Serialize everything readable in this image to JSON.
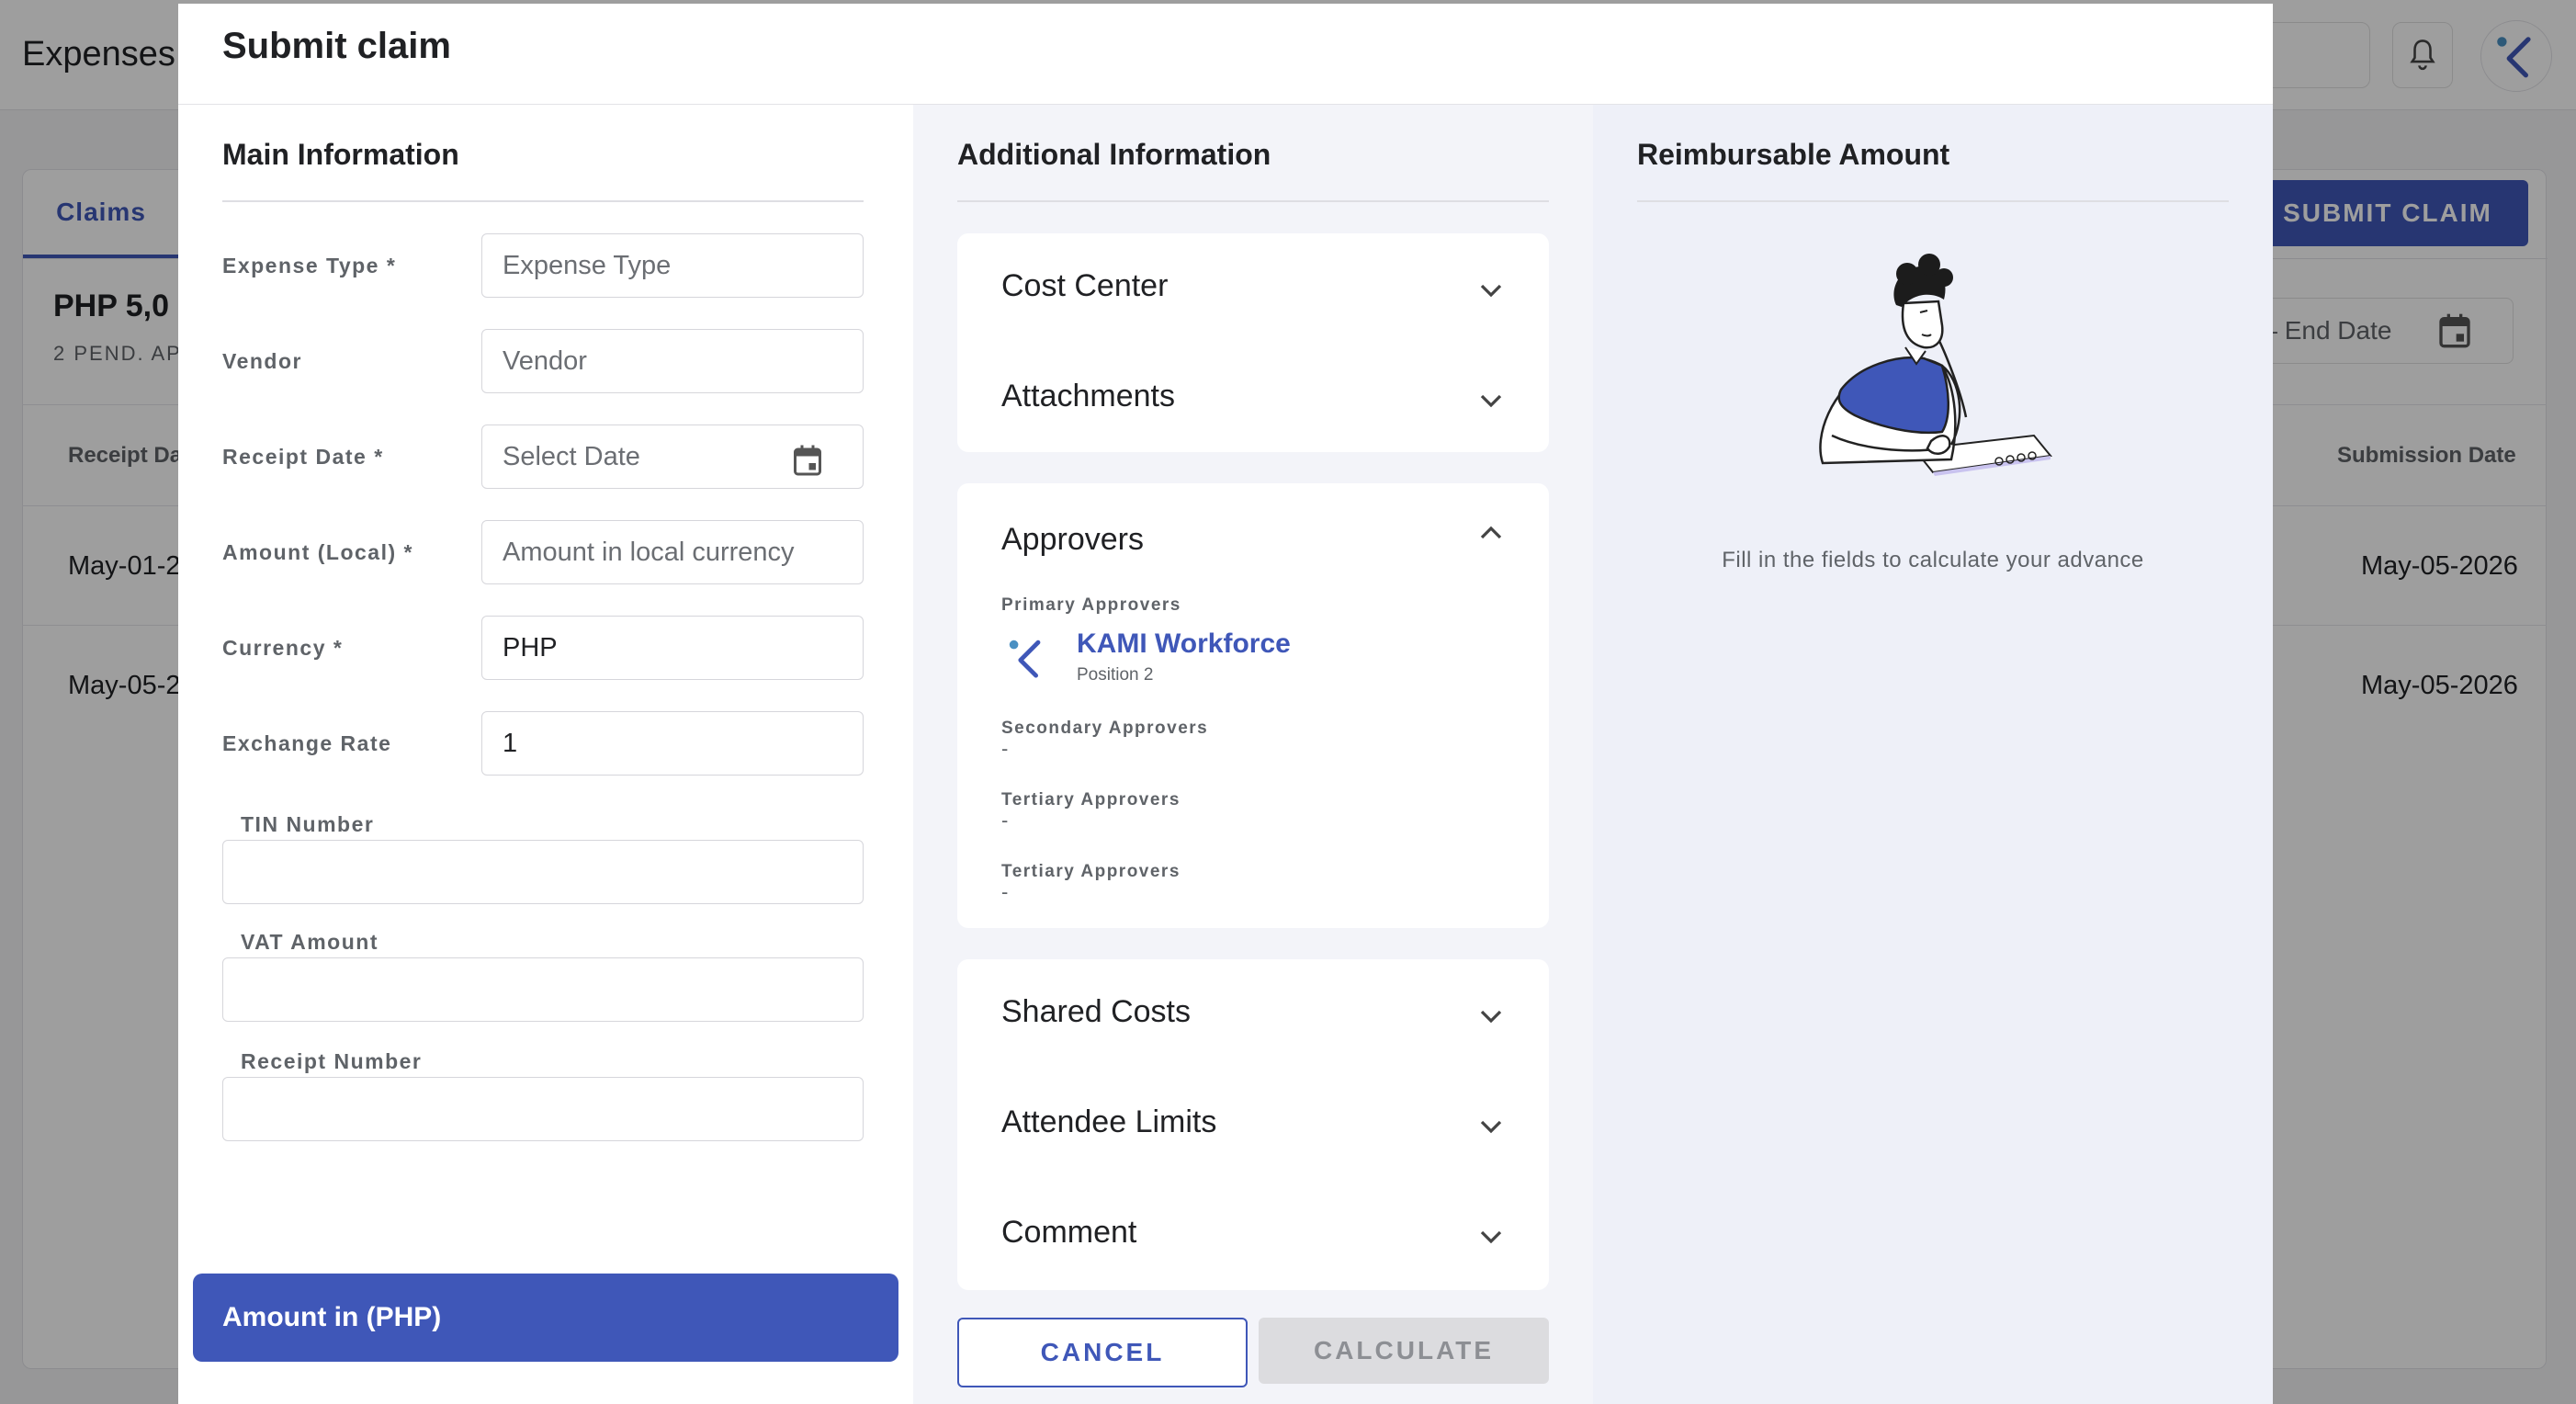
{
  "background": {
    "app_title": "Expenses",
    "tab_claims": "Claims",
    "submit_claim_button": "SUBMIT CLAIM",
    "total_amount": "PHP 5,0",
    "pending_text": "2  PEND. AP",
    "date_range_text": "e – End Date",
    "col_receipt_date": "Receipt Da",
    "col_submission_date": "Submission Date",
    "rows": [
      {
        "receipt_date": "May-01-2",
        "submission_date": "May-05-2026"
      },
      {
        "receipt_date": "May-05-2",
        "submission_date": "May-05-2026"
      }
    ]
  },
  "modal": {
    "title": "Submit claim",
    "main": {
      "title": "Main Information",
      "fields": {
        "expense_type": {
          "label": "Expense Type",
          "required": "*",
          "placeholder": "Expense Type"
        },
        "vendor": {
          "label": "Vendor",
          "placeholder": "Vendor"
        },
        "receipt_date": {
          "label": "Receipt Date",
          "required": "*",
          "placeholder": "Select Date"
        },
        "amount_local": {
          "label": "Amount (Local)",
          "required": "*",
          "placeholder": "Amount in local currency"
        },
        "currency": {
          "label": "Currency",
          "required": "*",
          "value": "PHP"
        },
        "exchange_rate": {
          "label": "Exchange Rate",
          "value": "1"
        },
        "tin_number": {
          "label": "TIN Number",
          "value": ""
        },
        "vat_amount": {
          "label": "VAT Amount",
          "value": ""
        },
        "receipt_number": {
          "label": "Receipt Number",
          "value": ""
        }
      },
      "amount_bar_label": "Amount in (PHP)"
    },
    "additional": {
      "title": "Additional Information",
      "cost_center": "Cost Center",
      "attachments": "Attachments",
      "approvers": {
        "title": "Approvers",
        "primary_label": "Primary Approvers",
        "primary_name": "KAMI Workforce",
        "primary_position": "Position 2",
        "secondary_label": "Secondary Approvers",
        "secondary_value": "-",
        "tertiary_label_1": "Tertiary Approvers",
        "tertiary_value_1": "-",
        "tertiary_label_2": "Tertiary Approvers",
        "tertiary_value_2": "-"
      },
      "shared_costs": "Shared Costs",
      "attendee_limits": "Attendee Limits",
      "comment": "Comment",
      "cancel_button": "CANCEL",
      "calculate_button": "CALCULATE"
    },
    "reimbursable": {
      "title": "Reimbursable Amount",
      "hint": "Fill in the fields to calculate your advance"
    }
  },
  "colors": {
    "accent": "#3f57b8",
    "overlay": "rgba(0,0,0,0.38)",
    "disabled_bg": "#dcdcdf"
  }
}
